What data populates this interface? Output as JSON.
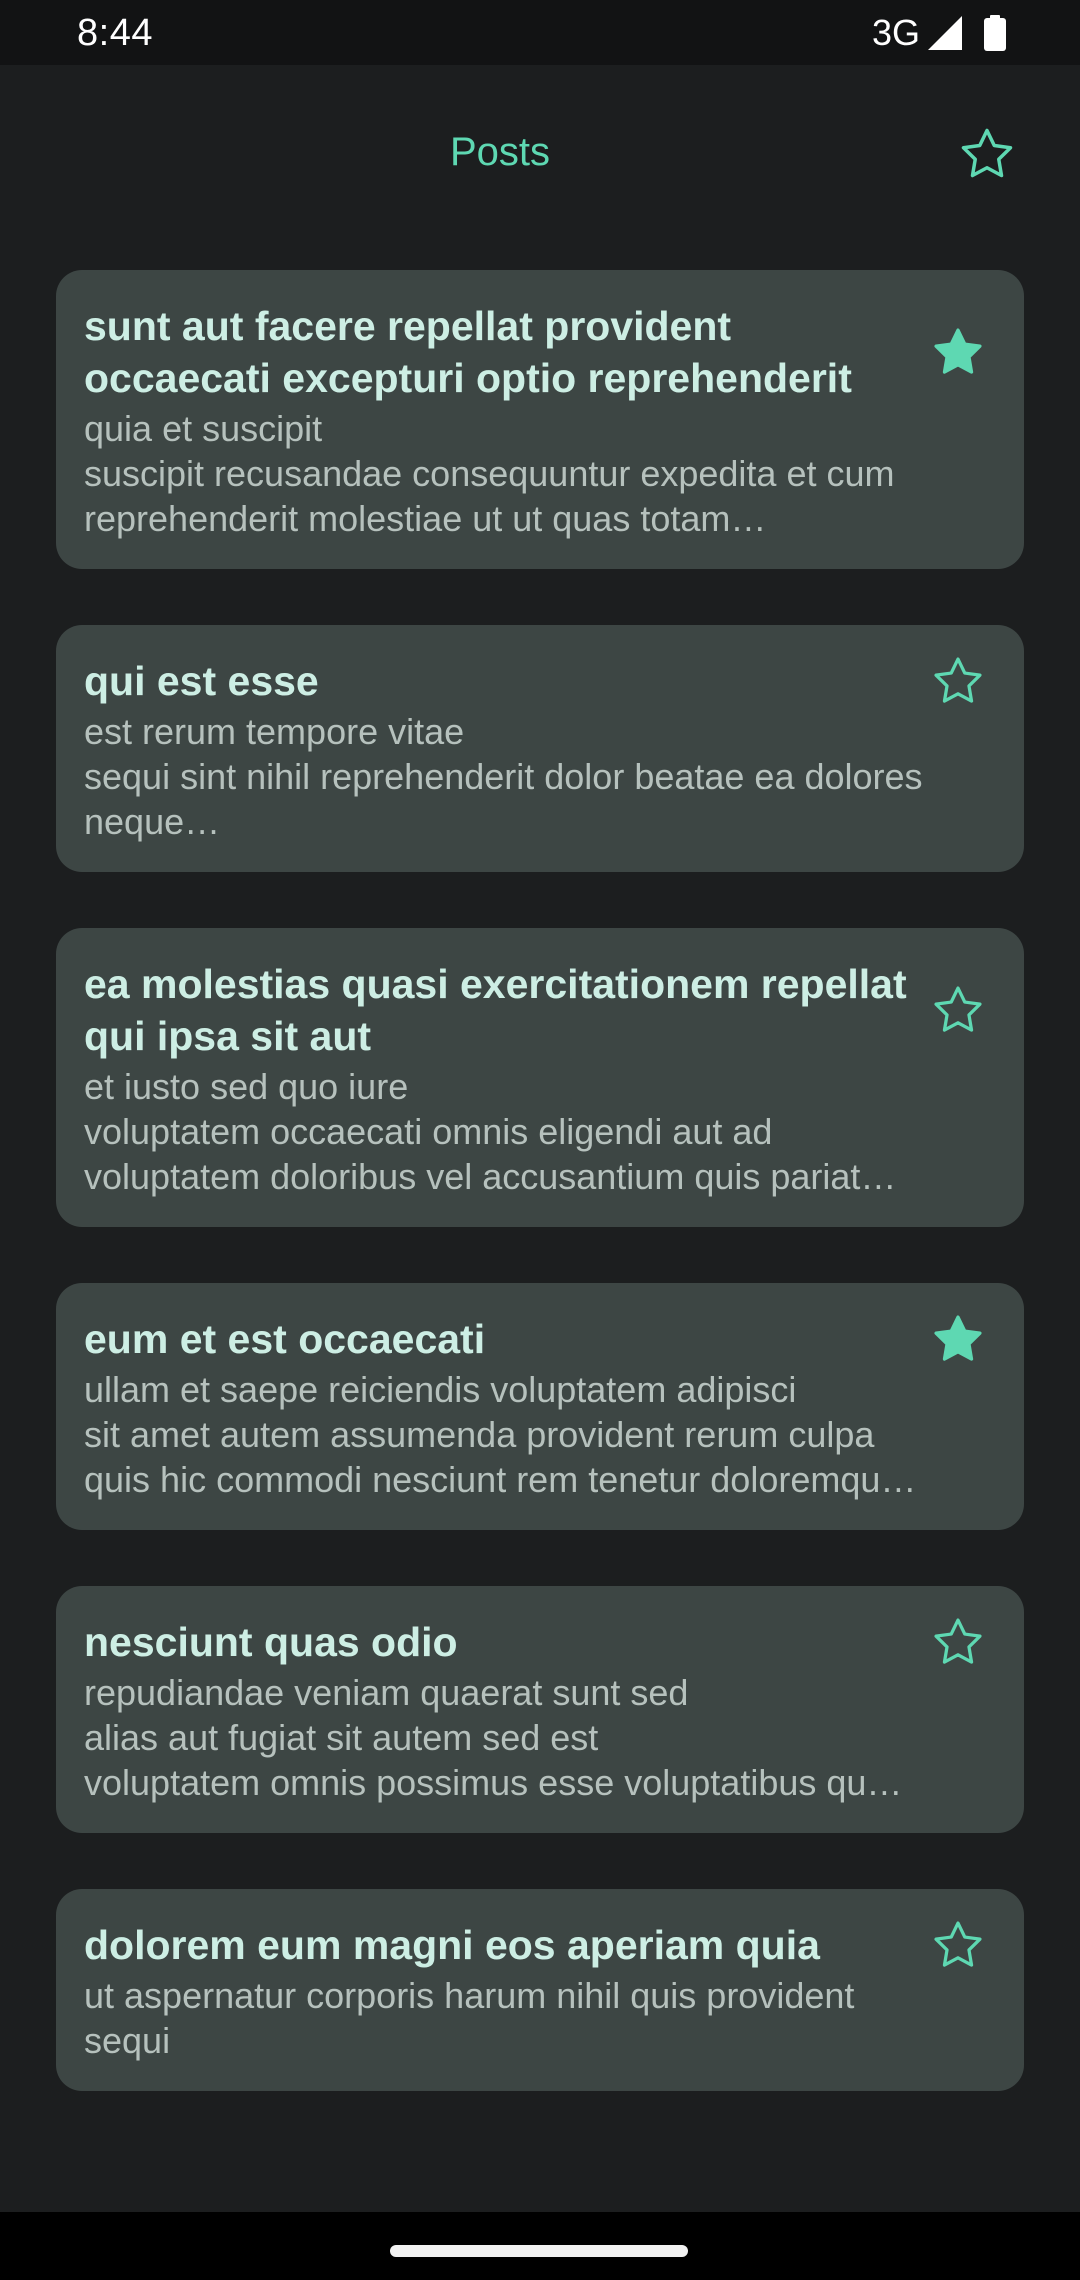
{
  "status_bar": {
    "time": "8:44",
    "network": "3G"
  },
  "app_bar": {
    "title": "Posts",
    "favorites_icon": "star-outline-icon"
  },
  "colors": {
    "accent": "#5ed8b2",
    "card_bg": "#3d4644",
    "background": "#1c1e1f"
  },
  "posts": [
    {
      "title": "sunt aut facere repellat provident occaecati excepturi optio reprehenderit",
      "body_lines": [
        "quia et suscipit",
        "suscipit recusandae consequuntur expedita et cum",
        "reprehenderit molestiae ut ut quas totam…"
      ],
      "favorite": true
    },
    {
      "title": "qui est esse",
      "body_lines": [
        "est rerum tempore vitae",
        "sequi sint nihil reprehenderit dolor beatae ea dolores",
        "neque…"
      ],
      "favorite": false
    },
    {
      "title": "ea molestias quasi exercitationem repellat qui ipsa sit aut",
      "body_lines": [
        "et iusto sed quo iure",
        "voluptatem occaecati omnis eligendi aut ad",
        "voluptatem doloribus vel accusantium quis pariat…"
      ],
      "favorite": false
    },
    {
      "title": "eum et est occaecati",
      "body_lines": [
        "ullam et saepe reiciendis voluptatem adipisci",
        "sit amet autem assumenda provident rerum culpa",
        "quis hic commodi nesciunt rem tenetur doloremque i…"
      ],
      "favorite": true
    },
    {
      "title": "nesciunt quas odio",
      "body_lines": [
        "repudiandae veniam quaerat sunt sed",
        "alias aut fugiat sit autem sed est",
        "voluptatem omnis possimus esse voluptatibus qu…"
      ],
      "favorite": false
    },
    {
      "title": "dolorem eum magni eos aperiam quia",
      "body_lines": [
        "ut aspernatur corporis harum nihil quis provident",
        "sequi"
      ],
      "favorite": false
    }
  ]
}
